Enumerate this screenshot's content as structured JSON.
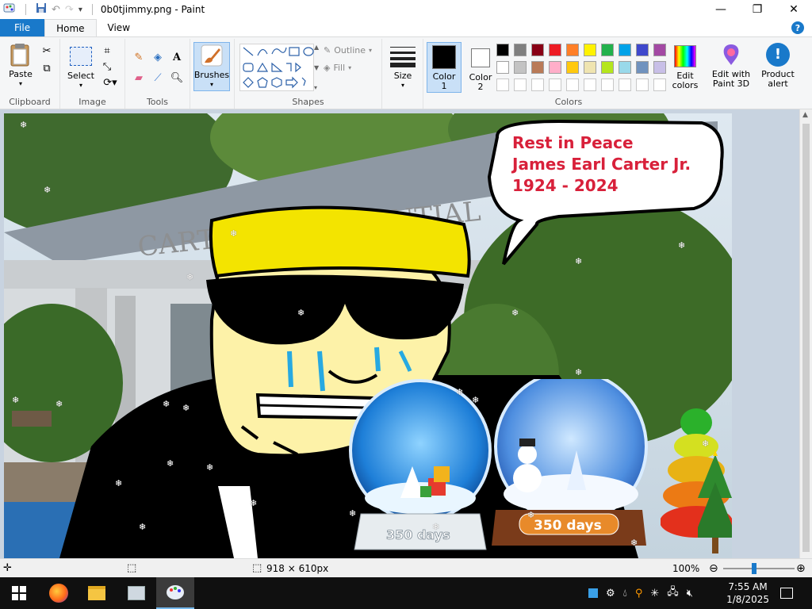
{
  "window": {
    "title": "0b0tjimmy.png - Paint",
    "controls": [
      "minimize-icon",
      "maximize-icon",
      "close-icon"
    ]
  },
  "tabs": [
    {
      "label": "File"
    },
    {
      "label": "Home"
    },
    {
      "label": "View"
    }
  ],
  "ribbon": {
    "clipboard": {
      "group_label": "Clipboard",
      "paste_label": "Paste"
    },
    "image": {
      "group_label": "Image",
      "select_label": "Select"
    },
    "tools": {
      "group_label": "Tools"
    },
    "brushes": {
      "label": "Brushes"
    },
    "shapes": {
      "group_label": "Shapes",
      "outline_label": "Outline",
      "fill_label": "Fill"
    },
    "size": {
      "label": "Size"
    },
    "colors": {
      "group_label": "Colors",
      "color1_label": "Color",
      "color1_sub": "1",
      "color2_label": "Color",
      "color2_sub": "2",
      "color1_value": "#000000",
      "color2_value": "#ffffff",
      "palette_row1": [
        "#000000",
        "#7f7f7f",
        "#880015",
        "#ed1c24",
        "#ff7f27",
        "#fff200",
        "#22b14c",
        "#00a2e8",
        "#3f48cc",
        "#a349a4"
      ],
      "palette_row2": [
        "#ffffff",
        "#c3c3c3",
        "#b97a57",
        "#ffaec9",
        "#ffc90e",
        "#efe4b0",
        "#b5e61d",
        "#99d9ea",
        "#7092be",
        "#c8bfe7"
      ],
      "edit_colors_label": "Edit colors",
      "paint3d_label": "Edit with Paint 3D",
      "product_alert_label": "Product alert"
    }
  },
  "canvas": {
    "speech_bubble": {
      "line1": "Rest in Peace",
      "line2": "James Earl Carter Jr.",
      "line3": "1924 - 2024"
    },
    "building_sign": "CARTER PRESIDENTIAL",
    "globe_left_text": "350 days",
    "globe_right_text": "350 days"
  },
  "statusbar": {
    "dimensions": "918 × 610px",
    "zoom": "100%"
  },
  "taskbar": {
    "time": "7:55 AM",
    "date": "1/8/2025"
  }
}
